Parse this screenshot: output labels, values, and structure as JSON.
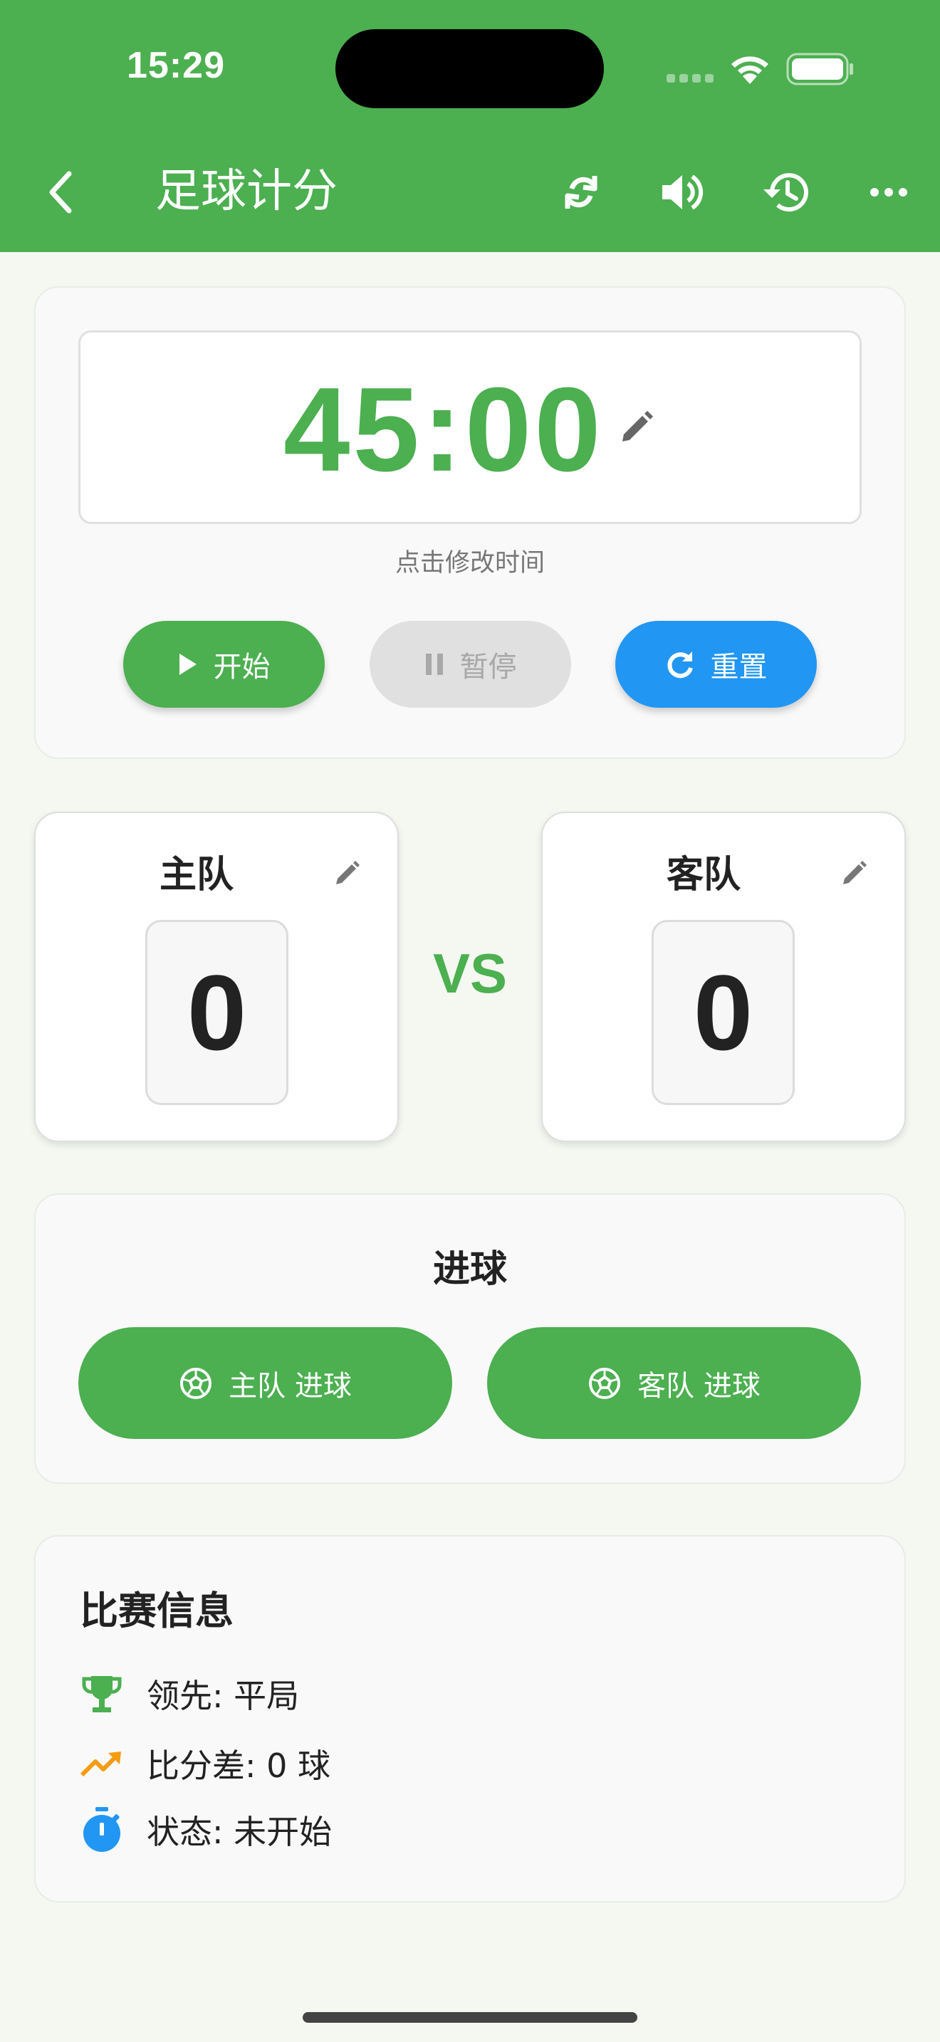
{
  "status_bar": {
    "time": "15:29"
  },
  "app_bar": {
    "title": "足球计分",
    "icons": [
      "back-icon",
      "swap-teams-icon",
      "sound-icon",
      "history-icon",
      "more-icon"
    ]
  },
  "timer": {
    "display": "45:00",
    "hint": "点击修改时间",
    "buttons": {
      "start": "开始",
      "pause": "暂停",
      "reset": "重置"
    }
  },
  "teams": {
    "home": {
      "name": "主队",
      "score": "0"
    },
    "away": {
      "name": "客队",
      "score": "0"
    },
    "vs": "VS"
  },
  "goal": {
    "title": "进球",
    "home_button": "主队 进球",
    "away_button": "客队 进球"
  },
  "match_info": {
    "title": "比赛信息",
    "leader": "领先: 平局",
    "score_diff": "比分差: 0 球",
    "status": "状态: 未开始"
  },
  "colors": {
    "primary": "#4caf50",
    "accent_blue": "#2196f3",
    "accent_orange": "#f39c12",
    "disabled": "#e0e0e0"
  }
}
